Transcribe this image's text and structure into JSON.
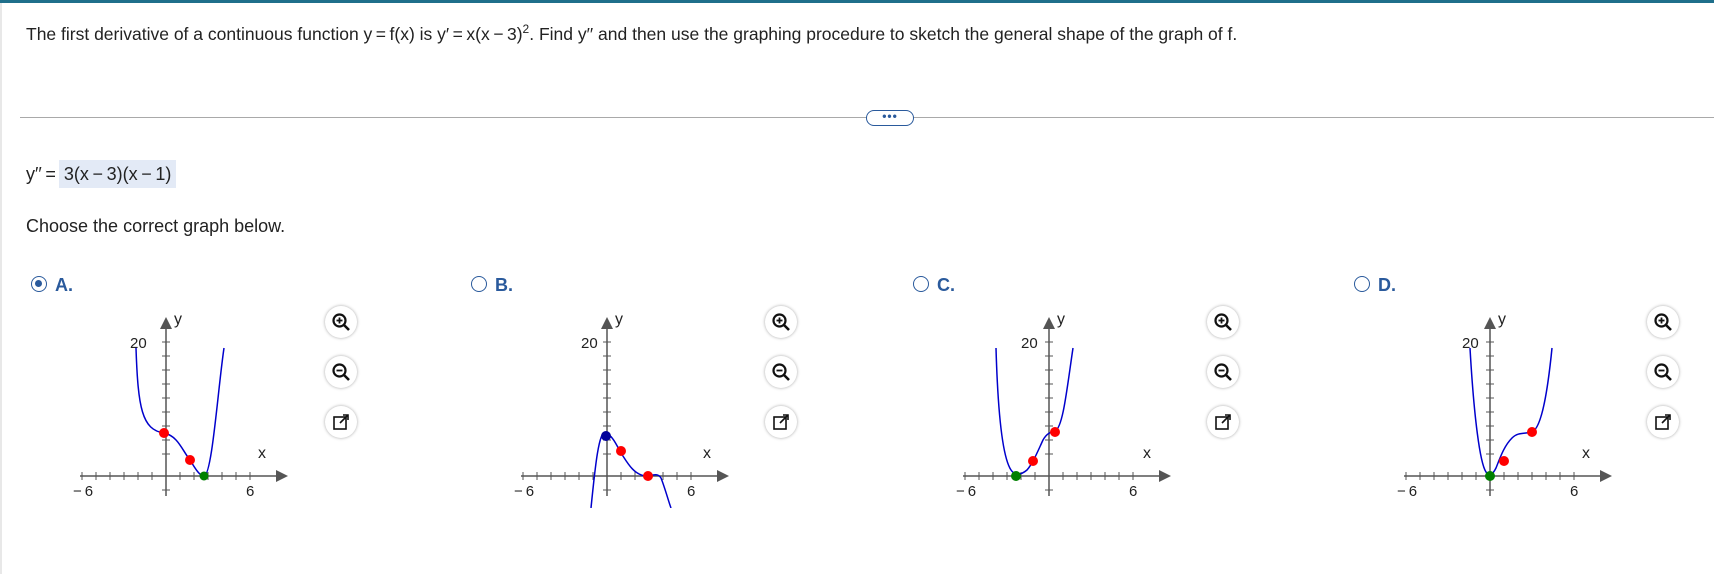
{
  "question": {
    "text_part1": "The first derivative of a continuous function y = f(x) is y′ = x(x − 3)",
    "exponent": "2",
    "text_part2": ". Find y′′ and then use the graphing procedure to sketch the general shape of the graph of f."
  },
  "more_button": {
    "label": "•••"
  },
  "answer": {
    "label": "y′′ =",
    "value": "3(x − 3)(x − 1)"
  },
  "instruction": "Choose the correct graph below.",
  "options": [
    {
      "letter": "A.",
      "selected": true
    },
    {
      "letter": "B.",
      "selected": false
    },
    {
      "letter": "C.",
      "selected": false
    },
    {
      "letter": "D.",
      "selected": false
    }
  ],
  "graph_labels": {
    "y_tick": "20",
    "x_min": "− 6",
    "x_max": "6",
    "y_axis": "y",
    "x_axis": "x"
  },
  "colors": {
    "curve": "#0000cc",
    "inflection": "#ff0000",
    "extremum_min": "#008000",
    "extremum_max": "#000099",
    "accent": "#2a5a9c"
  },
  "icons": {
    "zoom_in": "zoom-in-icon",
    "zoom_out": "zoom-out-icon",
    "popout": "popout-icon"
  }
}
